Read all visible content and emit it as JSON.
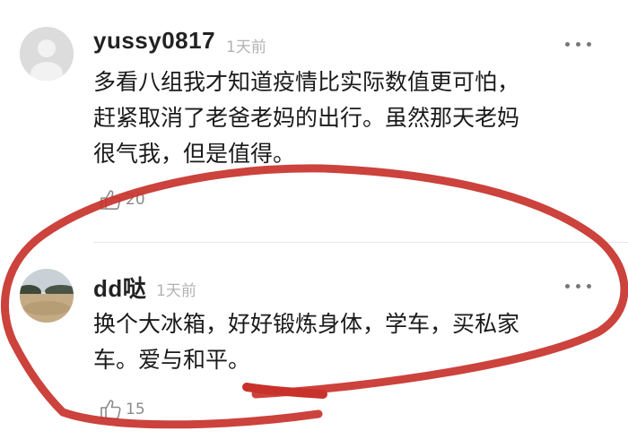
{
  "comments": [
    {
      "username": "yussy0817",
      "time": "1天前",
      "text_lines": [
        "多看八组我才知道疫情比实际数值更可怕，",
        "赶紧取消了老爸老妈的出行。虽然那天老妈",
        "很气我，但是值得。"
      ],
      "likes": "20"
    },
    {
      "username": "dd哒",
      "time": "1天前",
      "text_lines": [
        "换个大冰箱，好好锻炼身体，学车，买私家",
        "车。爱与和平。"
      ],
      "likes": "15"
    }
  ],
  "icons": {
    "more": "more-dots-icon",
    "like": "thumbs-up-icon"
  },
  "colors": {
    "scribble": "#c8322b",
    "username": "#222222",
    "meta": "#b3b3b3"
  }
}
